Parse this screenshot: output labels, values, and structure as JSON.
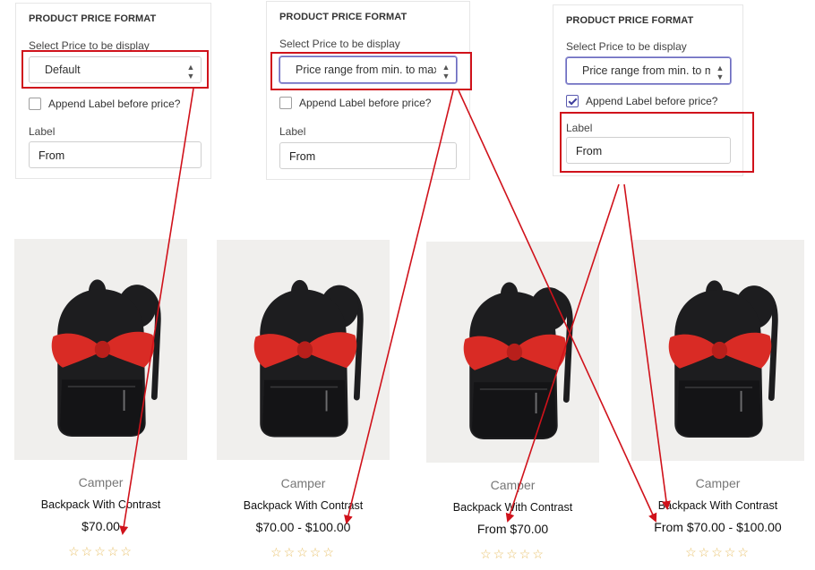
{
  "settings_panels": [
    {
      "title": "PRODUCT PRICE FORMAT",
      "select_label": "Select Price to be display",
      "select_value": "Default",
      "checkbox_label": "Append Label before price?",
      "checkbox_checked": false,
      "label_field_label": "Label",
      "label_field_value": "From"
    },
    {
      "title": "PRODUCT PRICE FORMAT",
      "select_label": "Select Price to be display",
      "select_value": "Price range from min. to max",
      "checkbox_label": "Append Label before price?",
      "checkbox_checked": false,
      "label_field_label": "Label",
      "label_field_value": "From"
    },
    {
      "title": "PRODUCT PRICE FORMAT",
      "select_label": "Select Price to be display",
      "select_value": "Price range from min. to max",
      "checkbox_label": "Append Label before price?",
      "checkbox_checked": true,
      "label_field_label": "Label",
      "label_field_value": "From"
    }
  ],
  "products": [
    {
      "vendor": "Camper",
      "title": "Backpack With Contrast",
      "price": "$70.00",
      "stars": "☆☆☆☆☆"
    },
    {
      "vendor": "Camper",
      "title": "Backpack With Contrast",
      "price": "$70.00 - $100.00",
      "stars": "☆☆☆☆☆"
    },
    {
      "vendor": "Camper",
      "title": "Backpack With Contrast",
      "price": "From $70.00",
      "stars": "☆☆☆☆☆"
    },
    {
      "vendor": "Camper",
      "title": "Backpack With Contrast",
      "price": "From $70.00 - $100.00",
      "stars": "☆☆☆☆☆"
    }
  ],
  "colors": {
    "annotation_red": "#d0121b",
    "bow_red": "#d92b25",
    "bag_black": "#1d1d1f",
    "star_gold": "#e8c16a",
    "image_background": "#f0efed"
  }
}
